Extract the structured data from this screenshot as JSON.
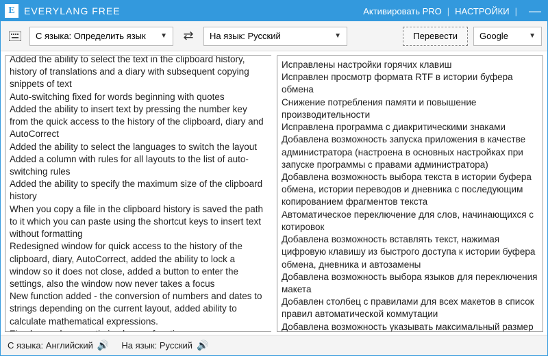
{
  "titlebar": {
    "app_name": "EVERYLANG FREE",
    "activate": "Активировать PRO",
    "settings": "НАСТРОЙКИ"
  },
  "toolbar": {
    "source_label": "С языка: Определить язык",
    "target_label": "На язык: Русский",
    "translate": "Перевести",
    "engine": "Google"
  },
  "left_text": [
    "Added the ability to select the text in the clipboard history, history of translations and a diary with subsequent copying snippets of text",
    "Auto-switching fixed for words beginning with quotes",
    "Added the ability to insert text by pressing the number key from the quick access to the history of the clipboard, diary and AutoCorrect",
    "Added the ability to select the languages to switch the layout",
    "Added a column with rules for all layouts to the list of auto-switching rules",
    "Added the ability to specify the maximum size of the clipboard history",
    "When you copy a file in the clipboard history is saved the path to it which you can paste using the shortcut keys to insert text without formatting",
    "Redesigned window for quick access to the history of the clipboard, diary, AutoCorrect, added the ability to lock a window so it does not close, added a button to enter the settings, also the window now never takes a focus",
    "New function added - the conversion of numbers and dates to strings depending on the current layout, added ability to calculate mathematical expressions.",
    "Fixed many bugs, optimized some functions"
  ],
  "right_text": [
    "Исправлены настройки горячих клавиш",
    "Исправлен просмотр формата RTF в истории буфера обмена",
    "Снижение потребления памяти и повышение производительности",
    "Исправлена программа с диакритическими знаками",
    "Добавлена возможность запуска приложения в качестве администратора (настроена в основных настройках при запуске программы с правами администратора)",
    "Добавлена возможность выбора текста в истории буфера обмена, истории переводов и дневника с последующим копированием фрагментов текста",
    "Автоматическое переключение для слов, начинающихся с котировок",
    "Добавлена возможность вставлять текст, нажимая цифровую клавишу из быстрого доступа к истории буфера обмена, дневника и автозамены",
    "Добавлена возможность выбора языков для переключения макета",
    "Добавлен столбец с правилами для всех макетов в список правил автоматической коммутации",
    "Добавлена возможность указывать максимальный размер истории буфера обмена"
  ],
  "status": {
    "source_lang": "С языка: Английский",
    "target_lang": "На язык: Русский"
  }
}
